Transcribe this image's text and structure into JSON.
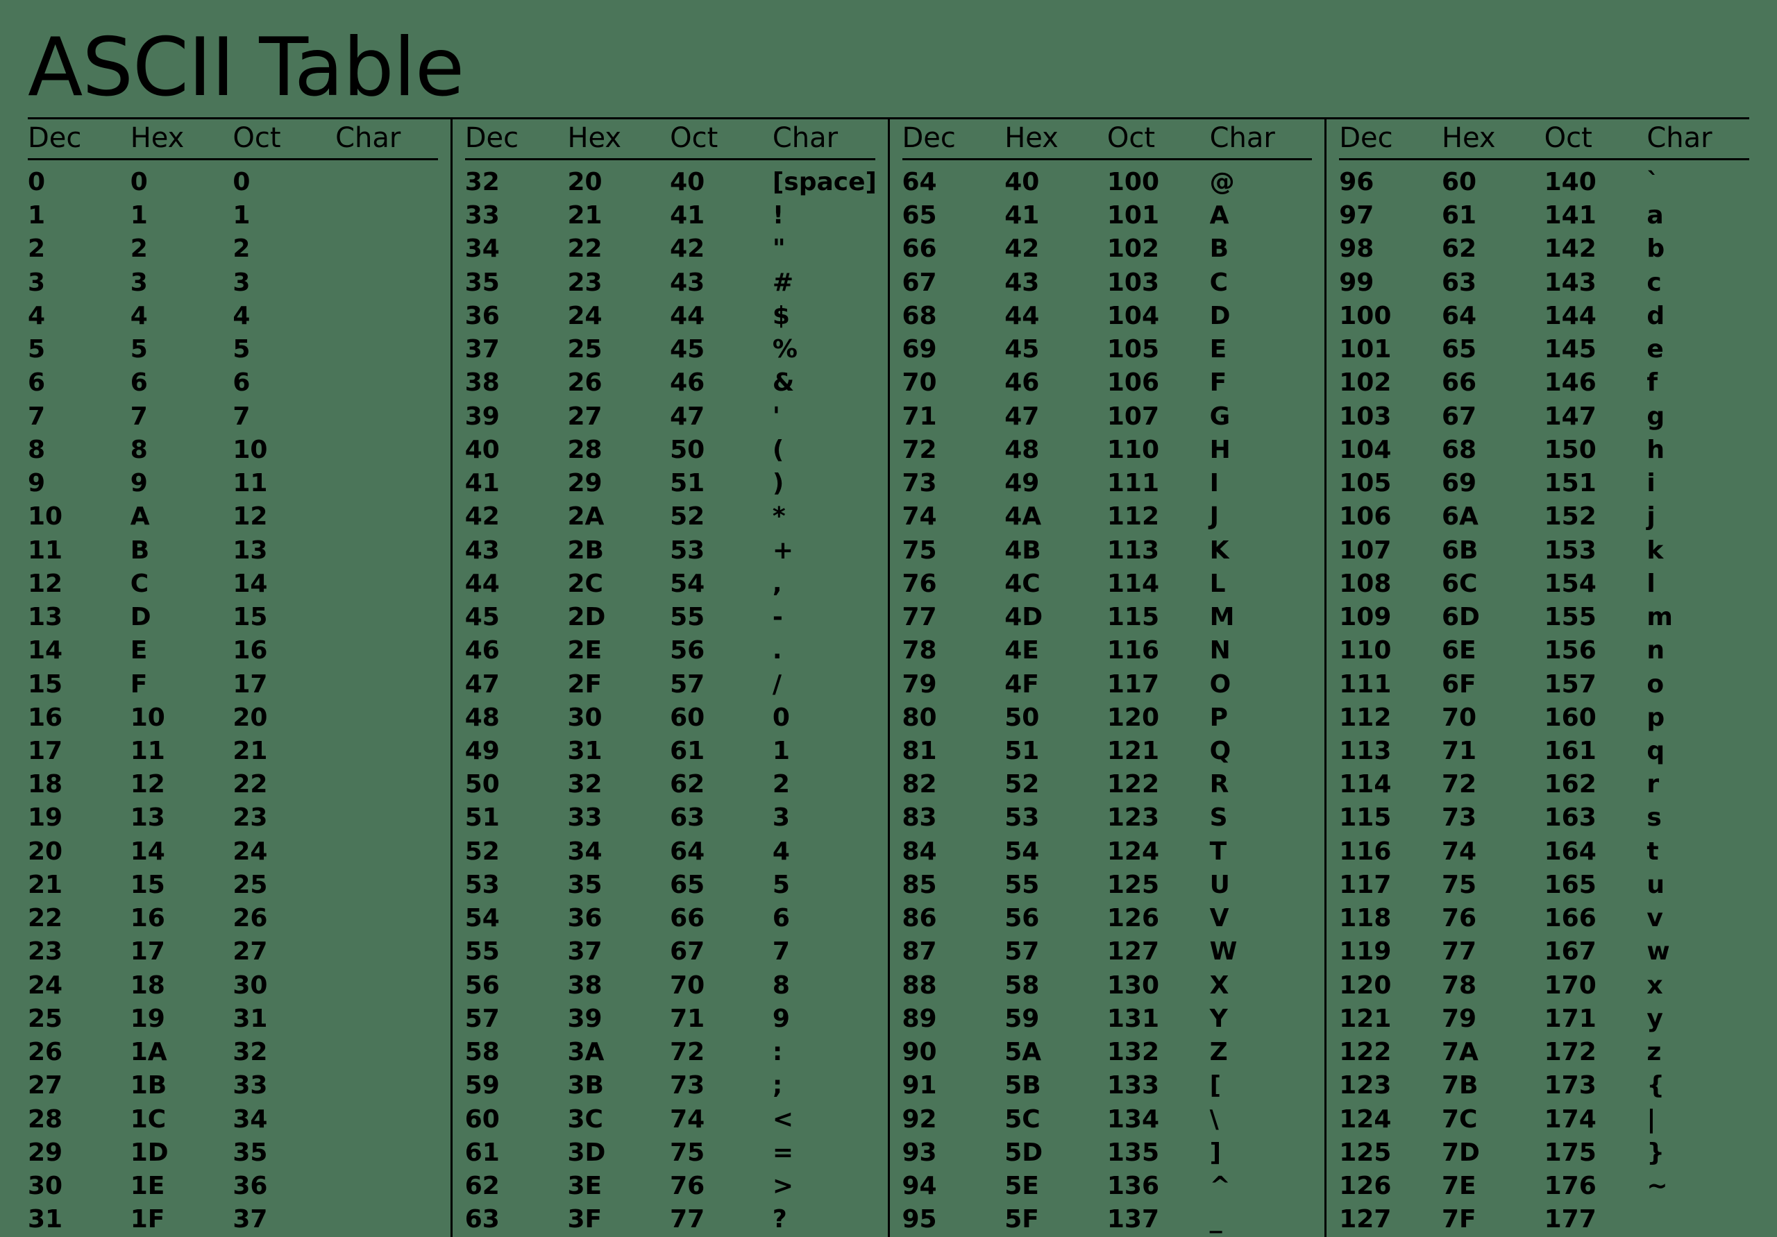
{
  "title": "ASCII Table",
  "headers": {
    "dec": "Dec",
    "hex": "Hex",
    "oct": "Oct",
    "chr": "Char"
  },
  "blocks": [
    {
      "rows": [
        {
          "dec": "0",
          "hex": "0",
          "oct": "0",
          "chr": ""
        },
        {
          "dec": "1",
          "hex": "1",
          "oct": "1",
          "chr": ""
        },
        {
          "dec": "2",
          "hex": "2",
          "oct": "2",
          "chr": ""
        },
        {
          "dec": "3",
          "hex": "3",
          "oct": "3",
          "chr": ""
        },
        {
          "dec": "4",
          "hex": "4",
          "oct": "4",
          "chr": ""
        },
        {
          "dec": "5",
          "hex": "5",
          "oct": "5",
          "chr": ""
        },
        {
          "dec": "6",
          "hex": "6",
          "oct": "6",
          "chr": ""
        },
        {
          "dec": "7",
          "hex": "7",
          "oct": "7",
          "chr": ""
        },
        {
          "dec": "8",
          "hex": "8",
          "oct": "10",
          "chr": ""
        },
        {
          "dec": "9",
          "hex": "9",
          "oct": "11",
          "chr": ""
        },
        {
          "dec": "10",
          "hex": "A",
          "oct": "12",
          "chr": ""
        },
        {
          "dec": "11",
          "hex": "B",
          "oct": "13",
          "chr": ""
        },
        {
          "dec": "12",
          "hex": "C",
          "oct": "14",
          "chr": ""
        },
        {
          "dec": "13",
          "hex": "D",
          "oct": "15",
          "chr": ""
        },
        {
          "dec": "14",
          "hex": "E",
          "oct": "16",
          "chr": ""
        },
        {
          "dec": "15",
          "hex": "F",
          "oct": "17",
          "chr": ""
        },
        {
          "dec": "16",
          "hex": "10",
          "oct": "20",
          "chr": ""
        },
        {
          "dec": "17",
          "hex": "11",
          "oct": "21",
          "chr": ""
        },
        {
          "dec": "18",
          "hex": "12",
          "oct": "22",
          "chr": ""
        },
        {
          "dec": "19",
          "hex": "13",
          "oct": "23",
          "chr": ""
        },
        {
          "dec": "20",
          "hex": "14",
          "oct": "24",
          "chr": ""
        },
        {
          "dec": "21",
          "hex": "15",
          "oct": "25",
          "chr": ""
        },
        {
          "dec": "22",
          "hex": "16",
          "oct": "26",
          "chr": ""
        },
        {
          "dec": "23",
          "hex": "17",
          "oct": "27",
          "chr": ""
        },
        {
          "dec": "24",
          "hex": "18",
          "oct": "30",
          "chr": ""
        },
        {
          "dec": "25",
          "hex": "19",
          "oct": "31",
          "chr": ""
        },
        {
          "dec": "26",
          "hex": "1A",
          "oct": "32",
          "chr": ""
        },
        {
          "dec": "27",
          "hex": "1B",
          "oct": "33",
          "chr": ""
        },
        {
          "dec": "28",
          "hex": "1C",
          "oct": "34",
          "chr": ""
        },
        {
          "dec": "29",
          "hex": "1D",
          "oct": "35",
          "chr": ""
        },
        {
          "dec": "30",
          "hex": "1E",
          "oct": "36",
          "chr": ""
        },
        {
          "dec": "31",
          "hex": "1F",
          "oct": "37",
          "chr": ""
        }
      ]
    },
    {
      "rows": [
        {
          "dec": "32",
          "hex": "20",
          "oct": "40",
          "chr": "[space]"
        },
        {
          "dec": "33",
          "hex": "21",
          "oct": "41",
          "chr": "!"
        },
        {
          "dec": "34",
          "hex": "22",
          "oct": "42",
          "chr": "\""
        },
        {
          "dec": "35",
          "hex": "23",
          "oct": "43",
          "chr": "#"
        },
        {
          "dec": "36",
          "hex": "24",
          "oct": "44",
          "chr": "$"
        },
        {
          "dec": "37",
          "hex": "25",
          "oct": "45",
          "chr": "%"
        },
        {
          "dec": "38",
          "hex": "26",
          "oct": "46",
          "chr": "&"
        },
        {
          "dec": "39",
          "hex": "27",
          "oct": "47",
          "chr": "'"
        },
        {
          "dec": "40",
          "hex": "28",
          "oct": "50",
          "chr": "("
        },
        {
          "dec": "41",
          "hex": "29",
          "oct": "51",
          "chr": ")"
        },
        {
          "dec": "42",
          "hex": "2A",
          "oct": "52",
          "chr": "*"
        },
        {
          "dec": "43",
          "hex": "2B",
          "oct": "53",
          "chr": "+"
        },
        {
          "dec": "44",
          "hex": "2C",
          "oct": "54",
          "chr": ","
        },
        {
          "dec": "45",
          "hex": "2D",
          "oct": "55",
          "chr": "-"
        },
        {
          "dec": "46",
          "hex": "2E",
          "oct": "56",
          "chr": "."
        },
        {
          "dec": "47",
          "hex": "2F",
          "oct": "57",
          "chr": "/"
        },
        {
          "dec": "48",
          "hex": "30",
          "oct": "60",
          "chr": "0"
        },
        {
          "dec": "49",
          "hex": "31",
          "oct": "61",
          "chr": "1"
        },
        {
          "dec": "50",
          "hex": "32",
          "oct": "62",
          "chr": "2"
        },
        {
          "dec": "51",
          "hex": "33",
          "oct": "63",
          "chr": "3"
        },
        {
          "dec": "52",
          "hex": "34",
          "oct": "64",
          "chr": "4"
        },
        {
          "dec": "53",
          "hex": "35",
          "oct": "65",
          "chr": "5"
        },
        {
          "dec": "54",
          "hex": "36",
          "oct": "66",
          "chr": "6"
        },
        {
          "dec": "55",
          "hex": "37",
          "oct": "67",
          "chr": "7"
        },
        {
          "dec": "56",
          "hex": "38",
          "oct": "70",
          "chr": "8"
        },
        {
          "dec": "57",
          "hex": "39",
          "oct": "71",
          "chr": "9"
        },
        {
          "dec": "58",
          "hex": "3A",
          "oct": "72",
          "chr": ":"
        },
        {
          "dec": "59",
          "hex": "3B",
          "oct": "73",
          "chr": ";"
        },
        {
          "dec": "60",
          "hex": "3C",
          "oct": "74",
          "chr": "<"
        },
        {
          "dec": "61",
          "hex": "3D",
          "oct": "75",
          "chr": "="
        },
        {
          "dec": "62",
          "hex": "3E",
          "oct": "76",
          "chr": ">"
        },
        {
          "dec": "63",
          "hex": "3F",
          "oct": "77",
          "chr": "?"
        }
      ]
    },
    {
      "rows": [
        {
          "dec": "64",
          "hex": "40",
          "oct": "100",
          "chr": "@"
        },
        {
          "dec": "65",
          "hex": "41",
          "oct": "101",
          "chr": "A"
        },
        {
          "dec": "66",
          "hex": "42",
          "oct": "102",
          "chr": "B"
        },
        {
          "dec": "67",
          "hex": "43",
          "oct": "103",
          "chr": "C"
        },
        {
          "dec": "68",
          "hex": "44",
          "oct": "104",
          "chr": "D"
        },
        {
          "dec": "69",
          "hex": "45",
          "oct": "105",
          "chr": "E"
        },
        {
          "dec": "70",
          "hex": "46",
          "oct": "106",
          "chr": "F"
        },
        {
          "dec": "71",
          "hex": "47",
          "oct": "107",
          "chr": "G"
        },
        {
          "dec": "72",
          "hex": "48",
          "oct": "110",
          "chr": "H"
        },
        {
          "dec": "73",
          "hex": "49",
          "oct": "111",
          "chr": "I"
        },
        {
          "dec": "74",
          "hex": "4A",
          "oct": "112",
          "chr": "J"
        },
        {
          "dec": "75",
          "hex": "4B",
          "oct": "113",
          "chr": "K"
        },
        {
          "dec": "76",
          "hex": "4C",
          "oct": "114",
          "chr": "L"
        },
        {
          "dec": "77",
          "hex": "4D",
          "oct": "115",
          "chr": "M"
        },
        {
          "dec": "78",
          "hex": "4E",
          "oct": "116",
          "chr": "N"
        },
        {
          "dec": "79",
          "hex": "4F",
          "oct": "117",
          "chr": "O"
        },
        {
          "dec": "80",
          "hex": "50",
          "oct": "120",
          "chr": "P"
        },
        {
          "dec": "81",
          "hex": "51",
          "oct": "121",
          "chr": "Q"
        },
        {
          "dec": "82",
          "hex": "52",
          "oct": "122",
          "chr": "R"
        },
        {
          "dec": "83",
          "hex": "53",
          "oct": "123",
          "chr": "S"
        },
        {
          "dec": "84",
          "hex": "54",
          "oct": "124",
          "chr": "T"
        },
        {
          "dec": "85",
          "hex": "55",
          "oct": "125",
          "chr": "U"
        },
        {
          "dec": "86",
          "hex": "56",
          "oct": "126",
          "chr": "V"
        },
        {
          "dec": "87",
          "hex": "57",
          "oct": "127",
          "chr": "W"
        },
        {
          "dec": "88",
          "hex": "58",
          "oct": "130",
          "chr": "X"
        },
        {
          "dec": "89",
          "hex": "59",
          "oct": "131",
          "chr": "Y"
        },
        {
          "dec": "90",
          "hex": "5A",
          "oct": "132",
          "chr": "Z"
        },
        {
          "dec": "91",
          "hex": "5B",
          "oct": "133",
          "chr": "["
        },
        {
          "dec": "92",
          "hex": "5C",
          "oct": "134",
          "chr": "\\"
        },
        {
          "dec": "93",
          "hex": "5D",
          "oct": "135",
          "chr": "]"
        },
        {
          "dec": "94",
          "hex": "5E",
          "oct": "136",
          "chr": "^"
        },
        {
          "dec": "95",
          "hex": "5F",
          "oct": "137",
          "chr": "_"
        }
      ]
    },
    {
      "rows": [
        {
          "dec": "96",
          "hex": "60",
          "oct": "140",
          "chr": "`"
        },
        {
          "dec": "97",
          "hex": "61",
          "oct": "141",
          "chr": "a"
        },
        {
          "dec": "98",
          "hex": "62",
          "oct": "142",
          "chr": "b"
        },
        {
          "dec": "99",
          "hex": "63",
          "oct": "143",
          "chr": "c"
        },
        {
          "dec": "100",
          "hex": "64",
          "oct": "144",
          "chr": "d"
        },
        {
          "dec": "101",
          "hex": "65",
          "oct": "145",
          "chr": "e"
        },
        {
          "dec": "102",
          "hex": "66",
          "oct": "146",
          "chr": "f"
        },
        {
          "dec": "103",
          "hex": "67",
          "oct": "147",
          "chr": "g"
        },
        {
          "dec": "104",
          "hex": "68",
          "oct": "150",
          "chr": "h"
        },
        {
          "dec": "105",
          "hex": "69",
          "oct": "151",
          "chr": "i"
        },
        {
          "dec": "106",
          "hex": "6A",
          "oct": "152",
          "chr": "j"
        },
        {
          "dec": "107",
          "hex": "6B",
          "oct": "153",
          "chr": "k"
        },
        {
          "dec": "108",
          "hex": "6C",
          "oct": "154",
          "chr": "l"
        },
        {
          "dec": "109",
          "hex": "6D",
          "oct": "155",
          "chr": "m"
        },
        {
          "dec": "110",
          "hex": "6E",
          "oct": "156",
          "chr": "n"
        },
        {
          "dec": "111",
          "hex": "6F",
          "oct": "157",
          "chr": "o"
        },
        {
          "dec": "112",
          "hex": "70",
          "oct": "160",
          "chr": "p"
        },
        {
          "dec": "113",
          "hex": "71",
          "oct": "161",
          "chr": "q"
        },
        {
          "dec": "114",
          "hex": "72",
          "oct": "162",
          "chr": "r"
        },
        {
          "dec": "115",
          "hex": "73",
          "oct": "163",
          "chr": "s"
        },
        {
          "dec": "116",
          "hex": "74",
          "oct": "164",
          "chr": "t"
        },
        {
          "dec": "117",
          "hex": "75",
          "oct": "165",
          "chr": "u"
        },
        {
          "dec": "118",
          "hex": "76",
          "oct": "166",
          "chr": "v"
        },
        {
          "dec": "119",
          "hex": "77",
          "oct": "167",
          "chr": "w"
        },
        {
          "dec": "120",
          "hex": "78",
          "oct": "170",
          "chr": "x"
        },
        {
          "dec": "121",
          "hex": "79",
          "oct": "171",
          "chr": "y"
        },
        {
          "dec": "122",
          "hex": "7A",
          "oct": "172",
          "chr": "z"
        },
        {
          "dec": "123",
          "hex": "7B",
          "oct": "173",
          "chr": "{"
        },
        {
          "dec": "124",
          "hex": "7C",
          "oct": "174",
          "chr": "|"
        },
        {
          "dec": "125",
          "hex": "7D",
          "oct": "175",
          "chr": "}"
        },
        {
          "dec": "126",
          "hex": "7E",
          "oct": "176",
          "chr": "~"
        },
        {
          "dec": "127",
          "hex": "7F",
          "oct": "177",
          "chr": ""
        }
      ]
    }
  ]
}
